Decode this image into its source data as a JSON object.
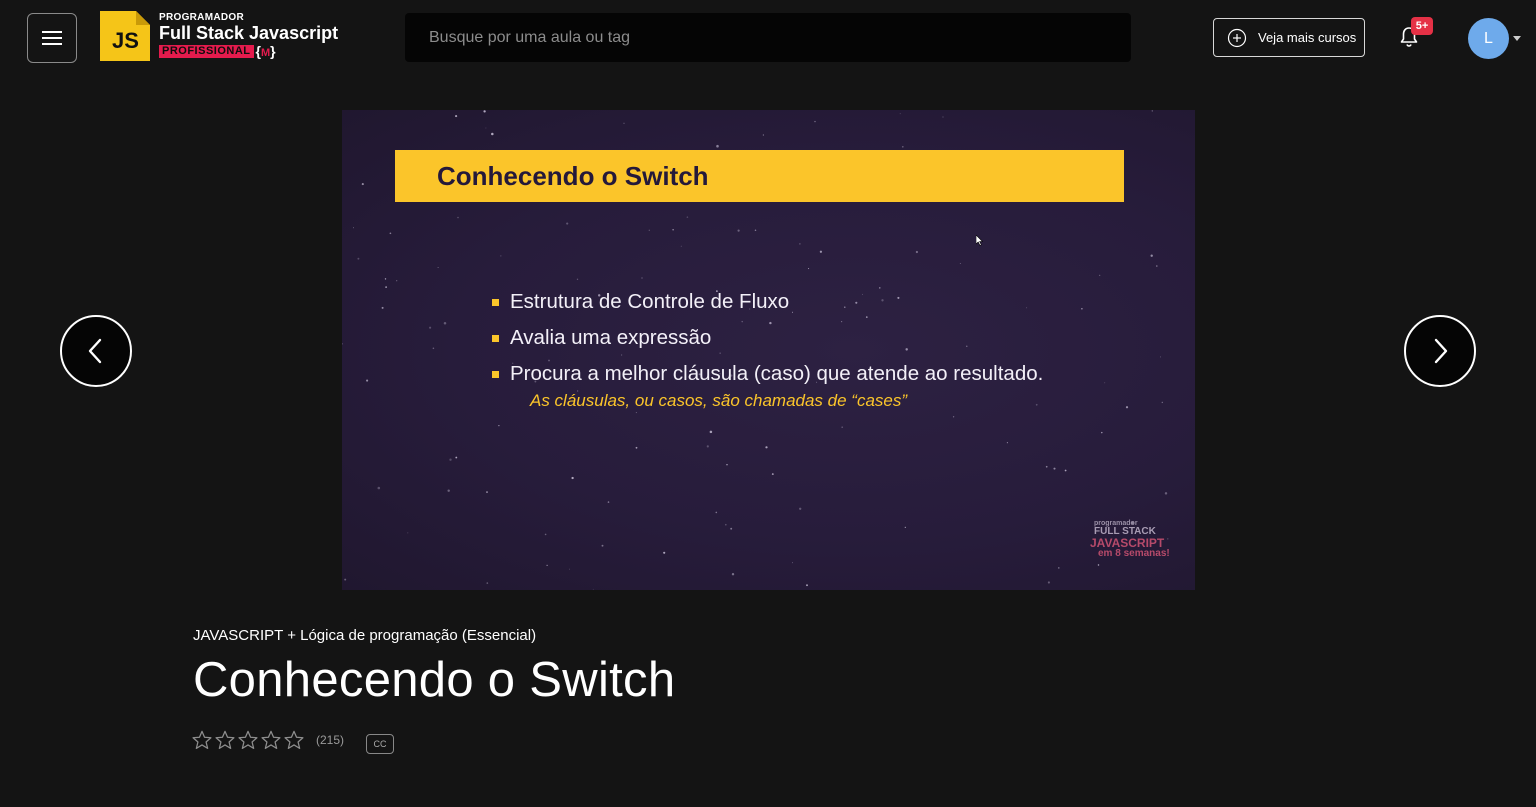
{
  "header": {
    "logo": {
      "badge_text": "JS",
      "superscript": "PROGRAMADOR",
      "main": "Full Stack Javascript",
      "sub": "PROFISSIONAL",
      "brace_open": "{",
      "brace_inner": "M",
      "brace_close": "}"
    },
    "search": {
      "placeholder": "Busque por uma aula ou tag",
      "value": ""
    },
    "more_courses_label": "Veja mais cursos",
    "notifications_badge": "5+",
    "avatar_initial": "L",
    "colors": {
      "background": "#141414",
      "accent": "#fbc52a",
      "badge": "#e53146",
      "avatar": "#6eaaeb"
    }
  },
  "video": {
    "slide_title": "Conhecendo o Switch",
    "bullets": [
      "Estrutura de Controle de Fluxo",
      "Avalia uma expressão",
      "Procura a melhor cláusula (caso) que atende ao resultado."
    ],
    "note": "As cláusulas, ou casos, são chamadas de “cases”",
    "watermark": {
      "line1": "programador",
      "line2": "FULL STACK",
      "line3": "JAVASCRIPT",
      "line4": "em 8 semanas!"
    }
  },
  "nav": {
    "prev_icon": "chevron-left-icon",
    "next_icon": "chevron-right-icon"
  },
  "lesson": {
    "course_name": "JAVASCRIPT + Lógica de programação (Essencial)",
    "title": "Conhecendo o Switch",
    "rating": {
      "stars_total": 5,
      "stars_filled": 0,
      "count": "(215)"
    },
    "cc_label": "CC"
  }
}
